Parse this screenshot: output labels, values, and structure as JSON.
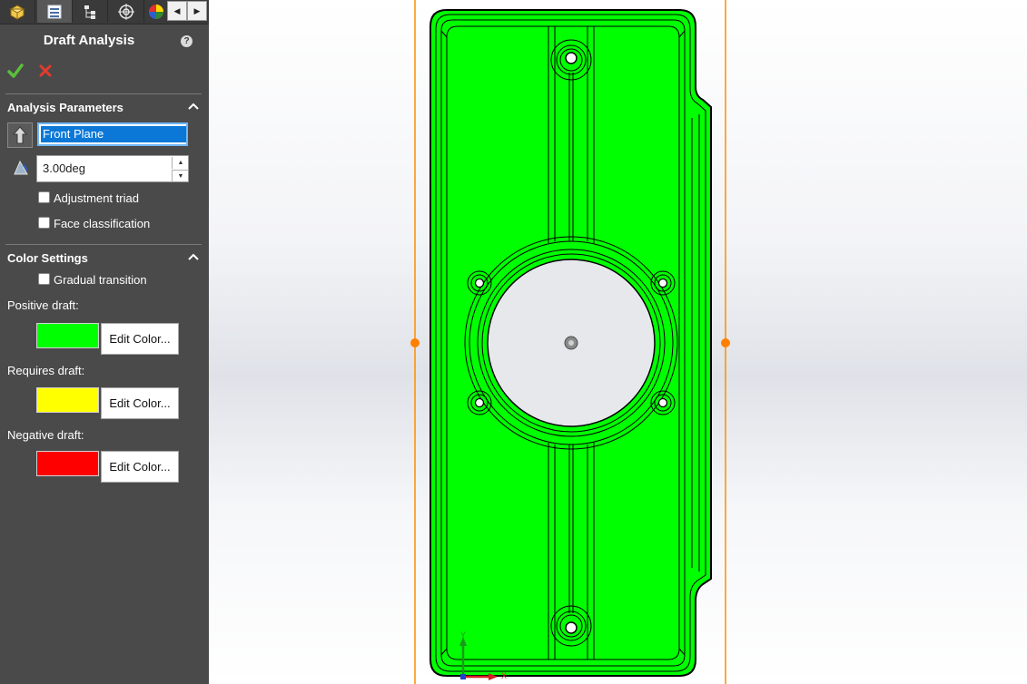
{
  "tabs": [
    {
      "name": "feature-manager-tab",
      "icon": "part-icon"
    },
    {
      "name": "property-manager-tab",
      "icon": "property-list-icon"
    },
    {
      "name": "configuration-manager-tab",
      "icon": "configuration-tree-icon"
    },
    {
      "name": "dimxpert-manager-tab",
      "icon": "crosshair-target-icon"
    },
    {
      "name": "display-manager-tab",
      "icon": "color-wheel-icon"
    }
  ],
  "property_manager": {
    "title": "Draft Analysis",
    "help_glyph": "?"
  },
  "analysis_parameters": {
    "header": "Analysis Parameters",
    "direction_of_pull": "Front Plane",
    "draft_angle": "3.00deg",
    "adjustment_triad": {
      "label": "Adjustment triad",
      "checked": false
    },
    "face_classification": {
      "label": "Face classification",
      "checked": false
    }
  },
  "color_settings": {
    "header": "Color Settings",
    "gradual_transition": {
      "label": "Gradual transition",
      "checked": false
    },
    "positive": {
      "label": "Positive draft:",
      "color": "#00ff00",
      "button": "Edit Color..."
    },
    "requires": {
      "label": "Requires draft:",
      "color": "#ffff00",
      "button": "Edit Color..."
    },
    "negative": {
      "label": "Negative draft:",
      "color": "#ff0000",
      "button": "Edit Color..."
    }
  },
  "triad": {
    "x_label": "X",
    "y_label": "Y"
  },
  "colors": {
    "panel_bg": "#4a4a4a",
    "part_face": "#00ff00",
    "bounding_plane": "#ff8c00",
    "selection_blue": "#0b78d7"
  }
}
